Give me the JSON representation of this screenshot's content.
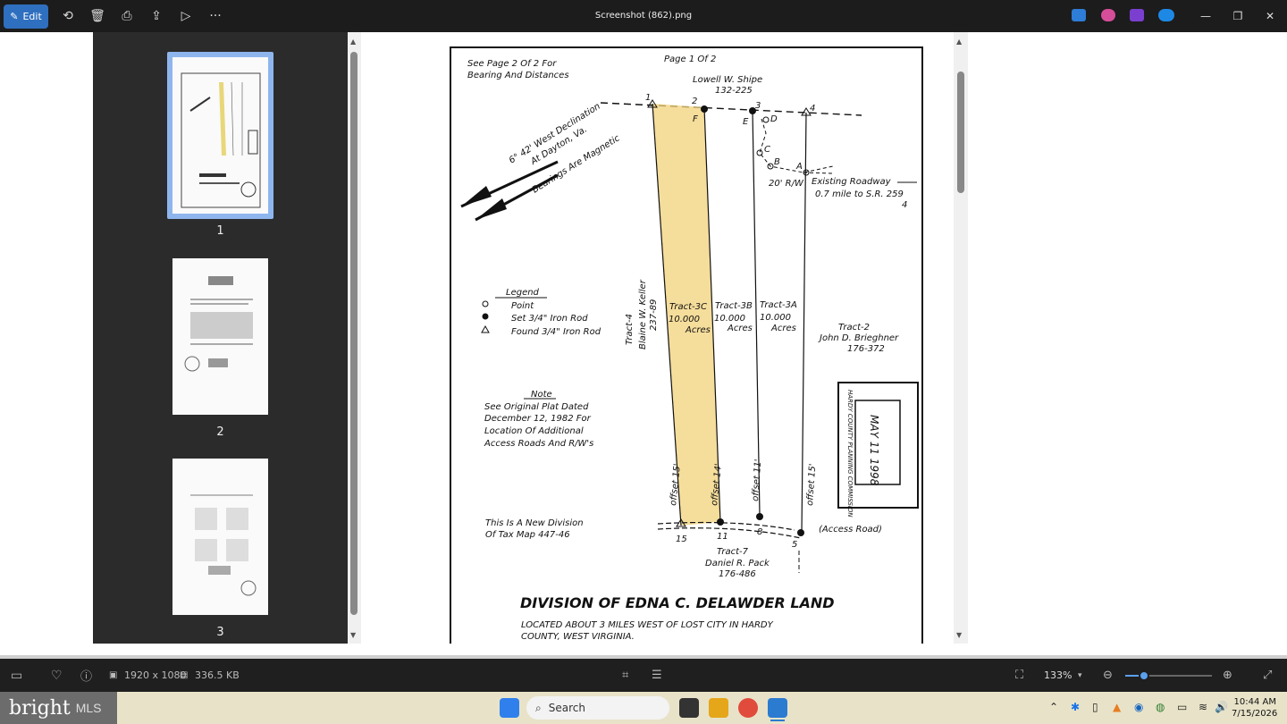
{
  "window": {
    "title": "Screenshot (862).png"
  },
  "toolbar": {
    "edit_label": "Edit"
  },
  "thumbnails": [
    {
      "num": "1"
    },
    {
      "num": "2"
    },
    {
      "num": "3"
    }
  ],
  "document": {
    "page_ref": "See Page 2 Of 2 For",
    "page_ref2": "Bearing And Distances",
    "page_num": "Page 1 Of 2",
    "owner_top": "Lowell W. Shipe",
    "owner_top_ref": "132-225",
    "declination1": "6° 42' West Declination",
    "declination2": "At Dayton, Va.",
    "declination3": "Bearings Are Magnetic",
    "roadway1": "Existing Roadway",
    "roadway2": "0.7 mile to S.R. 259",
    "roadway3": "4",
    "row": "20' R/W",
    "legend_title": "Legend",
    "legend_point": "Point",
    "legend_set": "Set 3/4\" Iron Rod",
    "legend_found": "Found 3/4\" Iron Rod",
    "tract4_a": "Tract-4",
    "tract4_b": "Blaine W. Keller",
    "tract4_c": "237-89",
    "tract3c": "Tract-3C",
    "tract3b": "Tract-3B",
    "tract3a": "Tract-3A",
    "acres_val": "10.000",
    "acres": "Acres",
    "tract2_a": "Tract-2",
    "tract2_b": "John D. Brieghner",
    "tract2_c": "176-372",
    "note_title": "Note",
    "note1": "See Original Plat Dated",
    "note2": "December 12, 1982 For",
    "note3": "Location Of Additional",
    "note4": "Access Roads And R/W's",
    "stamp1": "HARDY COUNTY PLANNING COMMISSION",
    "stamp2": "MAY 11 1998",
    "offset15": "offset 15'",
    "offset14": "offset 14'",
    "offset11": "offset 11'",
    "access_road": "(Access Road)",
    "new_div1": "This Is A New Division",
    "new_div2": "Of Tax Map 447-46",
    "tract7_a": "Tract-7",
    "tract7_b": "Daniel R. Pack",
    "tract7_c": "176-486",
    "main_title": "DIVISION OF EDNA C. DELAWDER LAND",
    "sub1": "LOCATED ABOUT 3 MILES WEST OF LOST CITY IN HARDY",
    "sub2": "COUNTY, WEST VIRGINIA.",
    "pts": {
      "p1": "1",
      "p2": "2",
      "p3": "3",
      "p4": "4",
      "pF": "F",
      "pE": "E",
      "pD": "D",
      "pC": "C",
      "pB": "B",
      "pA": "A",
      "p15": "15",
      "p11": "11",
      "p8": "8",
      "p5": "5"
    }
  },
  "status": {
    "dimensions": "1920 x 1080",
    "filesize": "336.5 KB",
    "zoom": "133%"
  },
  "taskbar": {
    "search_placeholder": "Search",
    "logo_text": "bright",
    "logo_sub": "MLS",
    "time": "10:44 AM",
    "date": "7/15/2026"
  }
}
